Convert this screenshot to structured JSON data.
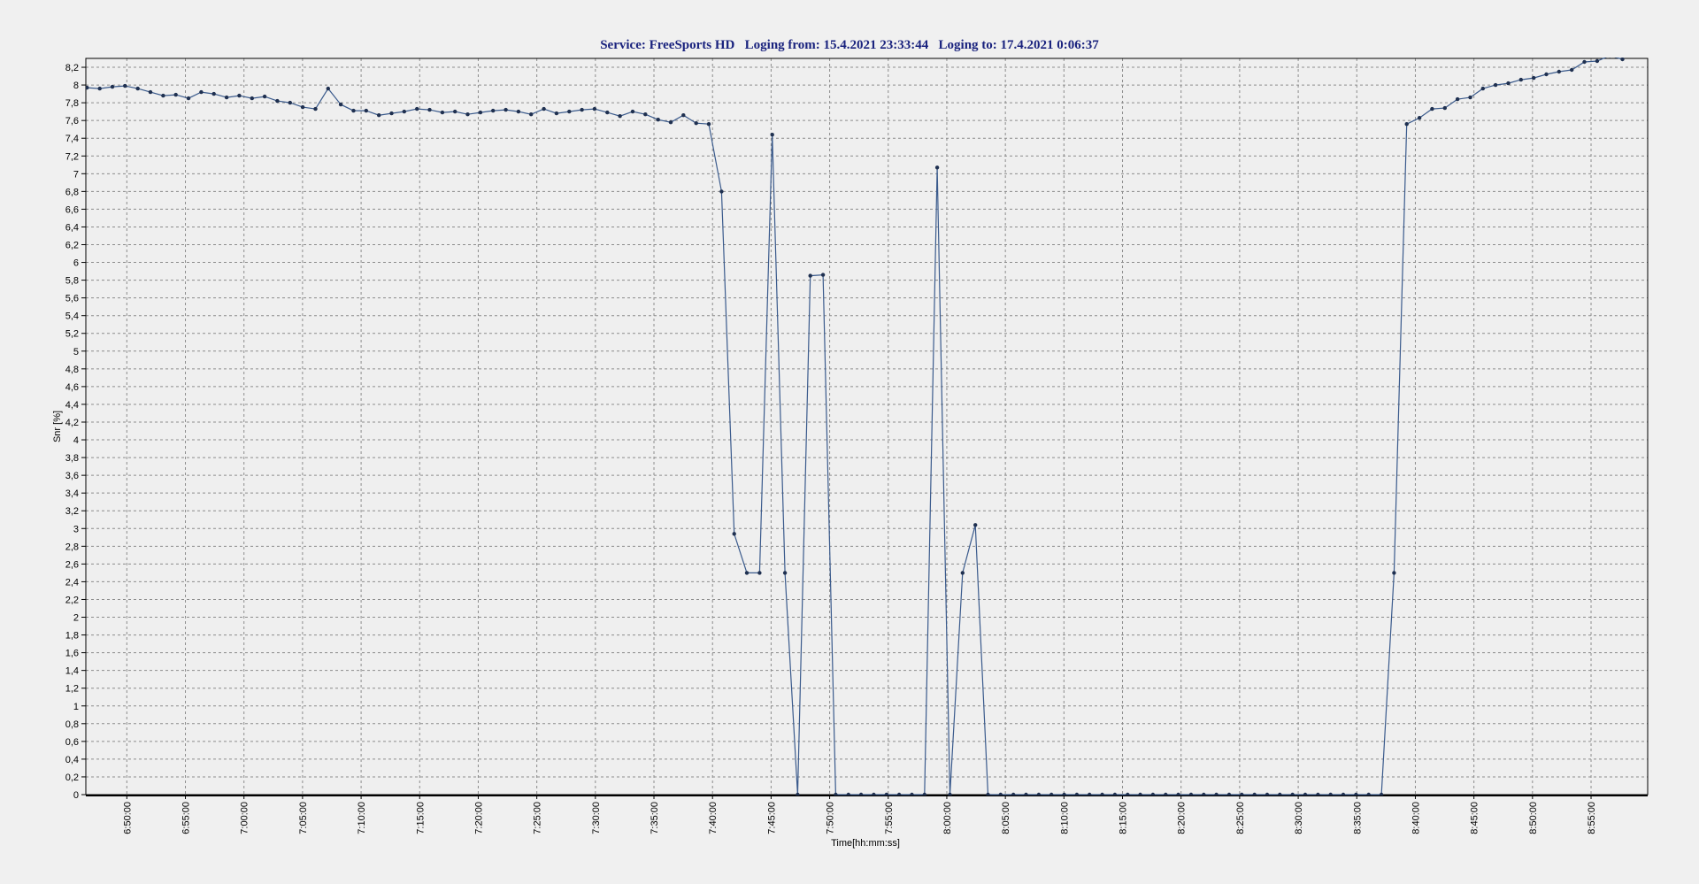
{
  "chart_data": {
    "type": "line",
    "title": "Service: FreeSports HD   Loging from: 15.4.2021 23:33:44   Loging to: 17.4.2021 0:06:37",
    "xlabel": "Time[hh:mm:ss]",
    "ylabel": "Snr [%]",
    "ylim": [
      0,
      8.3
    ],
    "y_ticks": [
      "0",
      "0,2",
      "0,4",
      "0,6",
      "0,8",
      "1",
      "1,2",
      "1,4",
      "1,6",
      "1,8",
      "2",
      "2,2",
      "2,4",
      "2,6",
      "2,8",
      "3",
      "3,2",
      "3,4",
      "3,6",
      "3,8",
      "4",
      "4,2",
      "4,4",
      "4,6",
      "4,8",
      "5",
      "5,2",
      "5,4",
      "5,6",
      "5,8",
      "6",
      "6,2",
      "6,4",
      "6,6",
      "6,8",
      "7",
      "7,2",
      "7,4",
      "7,6",
      "7,8",
      "8",
      "8,2"
    ],
    "x_ticks": [
      "6:50:00",
      "6:55:00",
      "7:00:00",
      "7:05:00",
      "7:10:00",
      "7:15:00",
      "7:20:00",
      "7:25:00",
      "7:30:00",
      "7:35:00",
      "7:40:00",
      "7:45:00",
      "7:50:00",
      "7:55:00",
      "8:00:00",
      "8:05:00",
      "8:10:00",
      "8:15:00",
      "8:20:00",
      "8:25:00",
      "8:30:00",
      "8:35:00",
      "8:40:00",
      "8:45:00",
      "8:50:00",
      "8:55:00"
    ],
    "xlim": [
      "6:46:30",
      "8:59:50"
    ],
    "grid": true,
    "series": [
      {
        "color": "#3a5a8c",
        "marker_color": "#1f3050",
        "points": [
          [
            "6:46:36",
            7.97
          ],
          [
            "6:47:41",
            7.96
          ],
          [
            "6:48:46",
            7.98
          ],
          [
            "6:49:51",
            7.99
          ],
          [
            "6:50:56",
            7.96
          ],
          [
            "6:52:01",
            7.92
          ],
          [
            "6:53:06",
            7.88
          ],
          [
            "6:54:11",
            7.89
          ],
          [
            "6:55:16",
            7.85
          ],
          [
            "6:56:21",
            7.92
          ],
          [
            "6:57:26",
            7.9
          ],
          [
            "6:58:31",
            7.86
          ],
          [
            "6:59:36",
            7.88
          ],
          [
            "7:00:41",
            7.85
          ],
          [
            "7:01:46",
            7.87
          ],
          [
            "7:02:51",
            7.82
          ],
          [
            "7:03:56",
            7.8
          ],
          [
            "7:05:01",
            7.75
          ],
          [
            "7:06:06",
            7.73
          ],
          [
            "7:07:11",
            7.96
          ],
          [
            "7:08:16",
            7.78
          ],
          [
            "7:09:21",
            7.71
          ],
          [
            "7:10:26",
            7.71
          ],
          [
            "7:11:31",
            7.66
          ],
          [
            "7:12:36",
            7.68
          ],
          [
            "7:13:41",
            7.7
          ],
          [
            "7:14:46",
            7.73
          ],
          [
            "7:15:51",
            7.72
          ],
          [
            "7:16:56",
            7.69
          ],
          [
            "7:18:01",
            7.7
          ],
          [
            "7:19:06",
            7.67
          ],
          [
            "7:20:11",
            7.69
          ],
          [
            "7:21:16",
            7.71
          ],
          [
            "7:22:21",
            7.72
          ],
          [
            "7:23:26",
            7.7
          ],
          [
            "7:24:31",
            7.67
          ],
          [
            "7:25:36",
            7.73
          ],
          [
            "7:26:41",
            7.68
          ],
          [
            "7:27:46",
            7.7
          ],
          [
            "7:28:51",
            7.72
          ],
          [
            "7:29:56",
            7.73
          ],
          [
            "7:31:01",
            7.69
          ],
          [
            "7:32:06",
            7.65
          ],
          [
            "7:33:11",
            7.7
          ],
          [
            "7:34:16",
            7.67
          ],
          [
            "7:35:21",
            7.61
          ],
          [
            "7:36:26",
            7.58
          ],
          [
            "7:37:31",
            7.66
          ],
          [
            "7:38:36",
            7.57
          ],
          [
            "7:39:41",
            7.56
          ],
          [
            "7:40:46",
            6.8
          ],
          [
            "7:41:51",
            2.94
          ],
          [
            "7:42:56",
            2.5
          ],
          [
            "7:44:01",
            2.5
          ],
          [
            "7:45:06",
            7.44
          ],
          [
            "7:46:11",
            2.5
          ],
          [
            "7:47:16",
            0
          ],
          [
            "7:48:21",
            5.85
          ],
          [
            "7:49:26",
            5.86
          ],
          [
            "7:50:31",
            0
          ],
          [
            "7:51:36",
            0
          ],
          [
            "7:52:41",
            0
          ],
          [
            "7:53:46",
            0
          ],
          [
            "7:54:51",
            0
          ],
          [
            "7:55:56",
            0
          ],
          [
            "7:57:01",
            0
          ],
          [
            "7:58:06",
            0
          ],
          [
            "7:59:11",
            7.07
          ],
          [
            "8:00:16",
            0
          ],
          [
            "8:01:21",
            2.5
          ],
          [
            "8:02:26",
            3.04
          ],
          [
            "8:03:31",
            0
          ],
          [
            "8:04:36",
            0
          ],
          [
            "8:05:41",
            0
          ],
          [
            "8:06:46",
            0
          ],
          [
            "8:07:51",
            0
          ],
          [
            "8:08:56",
            0
          ],
          [
            "8:10:01",
            0
          ],
          [
            "8:11:06",
            0
          ],
          [
            "8:12:11",
            0
          ],
          [
            "8:13:16",
            0
          ],
          [
            "8:14:21",
            0
          ],
          [
            "8:15:26",
            0
          ],
          [
            "8:16:31",
            0
          ],
          [
            "8:17:36",
            0
          ],
          [
            "8:18:41",
            0
          ],
          [
            "8:19:46",
            0
          ],
          [
            "8:20:51",
            0
          ],
          [
            "8:21:56",
            0
          ],
          [
            "8:23:01",
            0
          ],
          [
            "8:24:06",
            0
          ],
          [
            "8:25:11",
            0
          ],
          [
            "8:26:16",
            0
          ],
          [
            "8:27:21",
            0
          ],
          [
            "8:28:26",
            0
          ],
          [
            "8:29:31",
            0
          ],
          [
            "8:30:36",
            0
          ],
          [
            "8:31:41",
            0
          ],
          [
            "8:32:46",
            0
          ],
          [
            "8:33:51",
            0
          ],
          [
            "8:34:56",
            0
          ],
          [
            "8:36:01",
            0
          ],
          [
            "8:37:06",
            0
          ],
          [
            "8:38:11",
            2.5
          ],
          [
            "8:39:16",
            7.56
          ],
          [
            "8:40:21",
            7.63
          ],
          [
            "8:41:26",
            7.73
          ],
          [
            "8:42:31",
            7.74
          ],
          [
            "8:43:36",
            7.84
          ],
          [
            "8:44:41",
            7.86
          ],
          [
            "8:45:46",
            7.96
          ],
          [
            "8:46:51",
            8.0
          ],
          [
            "8:47:56",
            8.02
          ],
          [
            "8:49:01",
            8.06
          ],
          [
            "8:50:06",
            8.08
          ],
          [
            "8:51:11",
            8.12
          ],
          [
            "8:52:16",
            8.15
          ],
          [
            "8:53:21",
            8.17
          ],
          [
            "8:54:26",
            8.26
          ],
          [
            "8:55:31",
            8.27
          ],
          [
            "8:56:36",
            8.33
          ],
          [
            "8:57:41",
            8.29
          ]
        ]
      }
    ]
  }
}
